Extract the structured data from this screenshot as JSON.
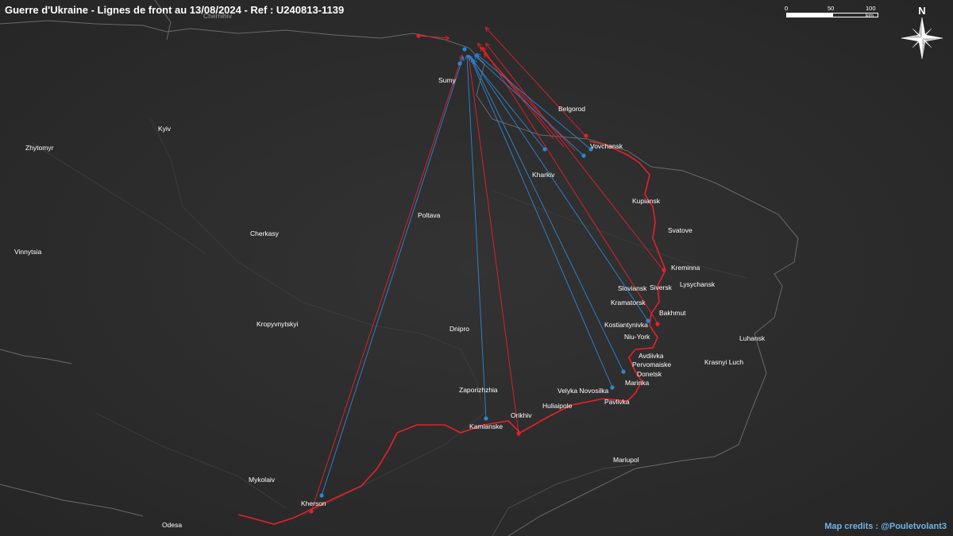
{
  "header": {
    "title": "Guerre d'Ukraine - Lignes de front au 13/08/2024 - Ref : U240813-1139"
  },
  "scale": {
    "labels": [
      "0",
      "50",
      "100 km"
    ]
  },
  "compass": {
    "label": "N"
  },
  "credits": "Map credits : @Pouletvolant3",
  "colors": {
    "background": "#2a2a2a",
    "russia": "#e8202a",
    "ukraine": "#2b86d6",
    "borders": "#6a6a6a",
    "text": "#ffffff",
    "credits": "#6fb3e8"
  },
  "cities": [
    {
      "key": "chernihiv",
      "name": "Chernihiv"
    },
    {
      "key": "kyiv",
      "name": "Kyiv"
    },
    {
      "key": "zhytomyr",
      "name": "Zhytomyr"
    },
    {
      "key": "sumy",
      "name": "Sumy"
    },
    {
      "key": "belgorod",
      "name": "Belgorod"
    },
    {
      "key": "vovchansk",
      "name": "Vovchansk"
    },
    {
      "key": "kharkiv",
      "name": "Kharkiv"
    },
    {
      "key": "kupiansk",
      "name": "Kupiansk"
    },
    {
      "key": "poltava",
      "name": "Poltava"
    },
    {
      "key": "svatove",
      "name": "Svatove"
    },
    {
      "key": "cherkasy",
      "name": "Cherkasy"
    },
    {
      "key": "vinnytsia",
      "name": "Vinnytsia"
    },
    {
      "key": "kreminna",
      "name": "Kreminna"
    },
    {
      "key": "sloviansk",
      "name": "Sloviansk"
    },
    {
      "key": "siversk",
      "name": "Siversk"
    },
    {
      "key": "lysychansk",
      "name": "Lysychansk"
    },
    {
      "key": "kramatorsk",
      "name": "Kramatorsk"
    },
    {
      "key": "bakhmut",
      "name": "Bakhmut"
    },
    {
      "key": "kostiantynivka",
      "name": "Kostiantynivka"
    },
    {
      "key": "kropyvnytskyi",
      "name": "Kropyvnytskyi"
    },
    {
      "key": "dnipro",
      "name": "Dnipro"
    },
    {
      "key": "luhansk",
      "name": "Luhansk"
    },
    {
      "key": "niuyork",
      "name": "Niu-York"
    },
    {
      "key": "avdiivka",
      "name": "Avdiivka"
    },
    {
      "key": "pervomaiske",
      "name": "Pervomaiske"
    },
    {
      "key": "krasnyiluch",
      "name": "Krasnyi Luch"
    },
    {
      "key": "donetsk",
      "name": "Donetsk"
    },
    {
      "key": "marinka",
      "name": "Marinka"
    },
    {
      "key": "zaporizhzhia",
      "name": "Zaporizhzhia"
    },
    {
      "key": "velykanovosilka",
      "name": "Velyka Novosilka"
    },
    {
      "key": "pavlivka",
      "name": "Pavlivka"
    },
    {
      "key": "huliaipole",
      "name": "Huliaipole"
    },
    {
      "key": "orikhiv",
      "name": "Orikhiv"
    },
    {
      "key": "kamianske",
      "name": "Kamianske"
    },
    {
      "key": "mariupol",
      "name": "Mariupol"
    },
    {
      "key": "mykolaiv",
      "name": "Mykolaiv"
    },
    {
      "key": "kherson",
      "name": "Kherson"
    },
    {
      "key": "odesa",
      "name": "Odesa"
    }
  ]
}
